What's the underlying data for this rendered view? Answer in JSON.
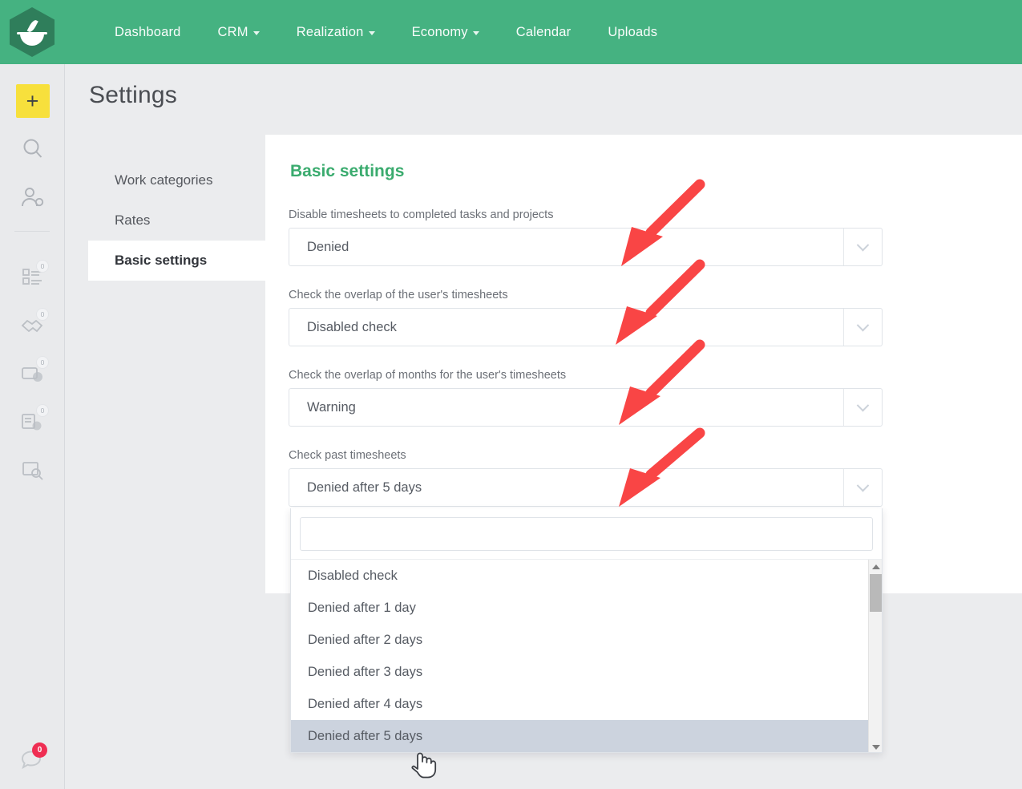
{
  "topnav": {
    "logo_name": "app-logo-bowl",
    "brand_color": "#45b281",
    "items": [
      {
        "label": "Dashboard",
        "has_caret": false
      },
      {
        "label": "CRM",
        "has_caret": true
      },
      {
        "label": "Realization",
        "has_caret": true
      },
      {
        "label": "Economy",
        "has_caret": true
      },
      {
        "label": "Calendar",
        "has_caret": false
      },
      {
        "label": "Uploads",
        "has_caret": false
      }
    ]
  },
  "rail": {
    "add_label": "+",
    "icons": [
      {
        "name": "add-icon",
        "badge": ""
      },
      {
        "name": "search-icon",
        "badge": ""
      },
      {
        "name": "user-add-icon",
        "badge": ""
      },
      {
        "name": "task-list-icon",
        "badge": "0"
      },
      {
        "name": "handshake-icon",
        "badge": "0"
      },
      {
        "name": "wallet-icon",
        "badge": "0"
      },
      {
        "name": "invoice-icon",
        "badge": "0"
      },
      {
        "name": "report-search-icon",
        "badge": ""
      }
    ],
    "chat": {
      "name": "chat-icon",
      "badge": "0",
      "badge_color": "#ef2e53"
    }
  },
  "page": {
    "title": "Settings",
    "subnav": [
      {
        "label": "Work categories",
        "active": false
      },
      {
        "label": "Rates",
        "active": false
      },
      {
        "label": "Basic settings",
        "active": true
      }
    ]
  },
  "card": {
    "title": "Basic settings",
    "title_color": "#3aab6e",
    "fields": [
      {
        "label": "Disable timesheets to completed tasks and projects",
        "value": "Denied"
      },
      {
        "label": "Check the overlap of the user's timesheets",
        "value": "Disabled check"
      },
      {
        "label": "Check the overlap of months for the user's timesheets",
        "value": "Warning"
      },
      {
        "label": "Check past timesheets",
        "value": "Denied after 5 days"
      }
    ]
  },
  "dropdown": {
    "open": true,
    "search_value": "",
    "search_placeholder": "",
    "options": [
      {
        "label": "Disabled check",
        "selected": false
      },
      {
        "label": "Denied after 1 day",
        "selected": false
      },
      {
        "label": "Denied after 2 days",
        "selected": false
      },
      {
        "label": "Denied after 3 days",
        "selected": false
      },
      {
        "label": "Denied after 4 days",
        "selected": false
      },
      {
        "label": "Denied after 5 days",
        "selected": true
      }
    ],
    "selected_color": "#ccd3de"
  },
  "annotations": {
    "arrow_color": "#f94545",
    "arrow_count": 4
  }
}
